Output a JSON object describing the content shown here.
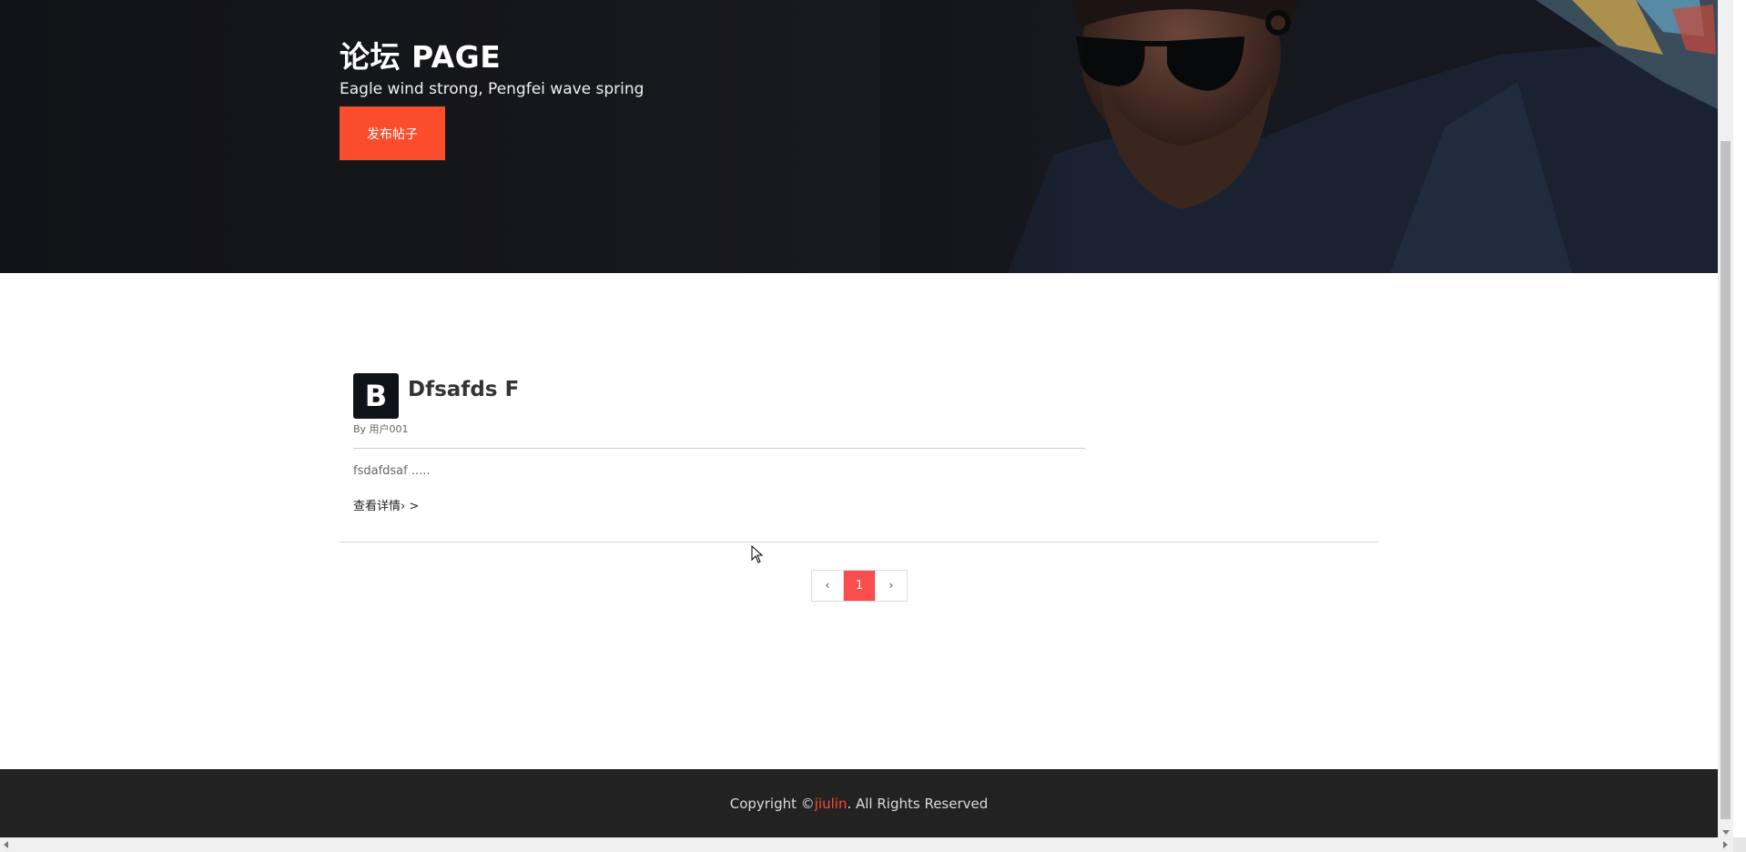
{
  "hero": {
    "title": "论坛 PAGE",
    "subtitle": "Eagle wind strong, Pengfei wave spring",
    "publish_button": "发布帖子"
  },
  "posts": [
    {
      "avatar_letter": "B",
      "title": "Dfsafds F",
      "author": "By 用户001",
      "excerpt": "fsdafdsaf .....",
      "link": "查看详情› >"
    }
  ],
  "pagination": {
    "prev": "‹",
    "current": "1",
    "next": "›"
  },
  "footer": {
    "prefix": "Copyright © ",
    "brand": "jiulin",
    "suffix": ". All Rights Reserved"
  },
  "colors": {
    "accent": "#fb4d2c",
    "page_active": "#fb4d4d",
    "hero_bg": "#141518",
    "footer_bg": "#222222"
  }
}
